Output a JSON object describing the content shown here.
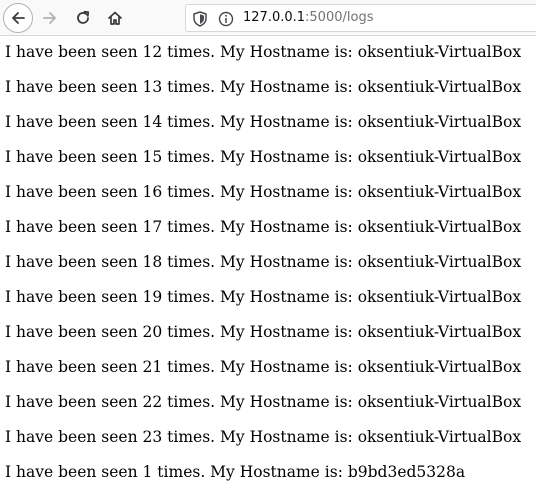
{
  "browser": {
    "url_host": "127.0.0.1",
    "url_rest": ":5000/logs"
  },
  "page": {
    "lines": [
      "I have been seen 12 times. My Hostname is: oksentiuk-VirtualBox",
      "I have been seen 13 times. My Hostname is: oksentiuk-VirtualBox",
      "I have been seen 14 times. My Hostname is: oksentiuk-VirtualBox",
      "I have been seen 15 times. My Hostname is: oksentiuk-VirtualBox",
      "I have been seen 16 times. My Hostname is: oksentiuk-VirtualBox",
      "I have been seen 17 times. My Hostname is: oksentiuk-VirtualBox",
      "I have been seen 18 times. My Hostname is: oksentiuk-VirtualBox",
      "I have been seen 19 times. My Hostname is: oksentiuk-VirtualBox",
      "I have been seen 20 times. My Hostname is: oksentiuk-VirtualBox",
      "I have been seen 21 times. My Hostname is: oksentiuk-VirtualBox",
      "I have been seen 22 times. My Hostname is: oksentiuk-VirtualBox",
      "I have been seen 23 times. My Hostname is: oksentiuk-VirtualBox",
      "I have been seen 1 times. My Hostname is: b9bd3ed5328a"
    ]
  },
  "icons": {
    "back": "arrow-left-icon",
    "forward": "arrow-right-icon",
    "reload": "reload-icon",
    "home": "home-icon",
    "tracking": "shield-icon",
    "site_info": "info-icon"
  }
}
